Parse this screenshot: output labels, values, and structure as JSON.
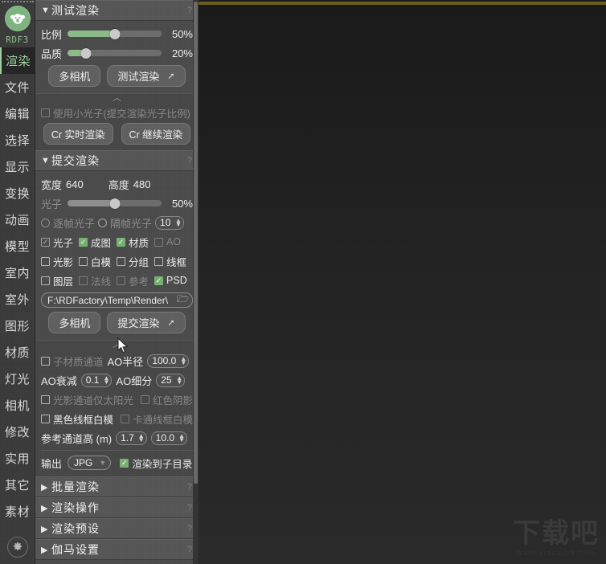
{
  "app": {
    "logo_label": "RDF3",
    "logo_icon": "koala-face-icon",
    "gear_icon": "gear-icon"
  },
  "sidebar": {
    "items": [
      {
        "label": "渲染",
        "active": true
      },
      {
        "label": "文件",
        "active": false
      },
      {
        "label": "编辑",
        "active": false
      },
      {
        "label": "选择",
        "active": false
      },
      {
        "label": "显示",
        "active": false
      },
      {
        "label": "变换",
        "active": false
      },
      {
        "label": "动画",
        "active": false
      },
      {
        "label": "模型",
        "active": false
      },
      {
        "label": "室内",
        "active": false
      },
      {
        "label": "室外",
        "active": false
      },
      {
        "label": "图形",
        "active": false
      },
      {
        "label": "材质",
        "active": false
      },
      {
        "label": "灯光",
        "active": false
      },
      {
        "label": "相机",
        "active": false
      },
      {
        "label": "修改",
        "active": false
      },
      {
        "label": "实用",
        "active": false
      },
      {
        "label": "其它",
        "active": false
      },
      {
        "label": "素材",
        "active": false
      }
    ]
  },
  "test_render": {
    "title": "测试渲染",
    "expanded_chevron": "▼",
    "help": "?",
    "scale_label": "比例",
    "scale_value": "50%",
    "scale_pct": 50,
    "quality_label": "品质",
    "quality_value": "20%",
    "quality_pct": 20,
    "multicam_button": "多相机",
    "test_render_button": "测试渲染",
    "test_render_button_icon": "up-arrow-icon"
  },
  "corona_sub": {
    "collapse_icon": "chevron-up-icon",
    "small_photon_label": "使用小光子(提交渲染光子比例)",
    "small_photon_checked": false,
    "realtime_button": "Cr 实时渲染",
    "continue_button": "Cr 继续渲染"
  },
  "submit_render": {
    "title": "提交渲染",
    "expanded_chevron": "▼",
    "help": "?",
    "width_label": "宽度",
    "width_value": "640",
    "height_label": "高度",
    "height_value": "480",
    "photon_label": "光子",
    "photon_value": "50%",
    "photon_pct": 50,
    "radio_per_frame": "逐帧光子",
    "radio_interval_frame": "隔帧光子",
    "interval_value": "10",
    "checks_row1": [
      {
        "label": "光子",
        "state": "checked-gray",
        "dim": false
      },
      {
        "label": "成图",
        "state": "checked-green",
        "dim": false
      },
      {
        "label": "材质",
        "state": "checked-green",
        "dim": false
      },
      {
        "label": "AO",
        "state": "unchecked",
        "dim": true
      }
    ],
    "checks_row2": [
      {
        "label": "光影",
        "state": "unchecked",
        "dim": false
      },
      {
        "label": "白模",
        "state": "unchecked",
        "dim": false
      },
      {
        "label": "分组",
        "state": "unchecked",
        "dim": false
      },
      {
        "label": "线框",
        "state": "unchecked",
        "dim": false
      }
    ],
    "checks_row3": [
      {
        "label": "图层",
        "state": "unchecked",
        "dim": false
      },
      {
        "label": "法线",
        "state": "unchecked",
        "dim": true
      },
      {
        "label": "参考",
        "state": "unchecked",
        "dim": true
      },
      {
        "label": "PSD",
        "state": "checked-green",
        "dim": false
      }
    ],
    "output_path": "F:\\RDFactory\\Temp\\Render\\",
    "folder_icon": "folder-icon",
    "multicam_button": "多相机",
    "submit_button": "提交渲染",
    "submit_button_icon": "up-arrow-icon"
  },
  "advanced": {
    "collapse_icon": "chevron-up-icon",
    "sub_material_channel": "子材质通道",
    "sub_material_checked": false,
    "ao_radius_label": "AO半径",
    "ao_radius_value": "100.0",
    "ao_falloff_label": "AO衰减",
    "ao_falloff_value": "0.1",
    "ao_subdiv_label": "AO细分",
    "ao_subdiv_value": "25",
    "shadow_sun_only": "光影通道仅太阳光",
    "shadow_sun_only_checked": false,
    "red_shadow": "红色阴影",
    "red_shadow_checked": false,
    "black_wire_white": "黑色线框白模",
    "black_wire_white_checked": false,
    "cartoon_wire_white": "卡通线框白模",
    "cartoon_wire_white_checked": false,
    "ref_channel_label": "参考通道高 (m)",
    "ref_height_value": "1.7",
    "ref_dist_value": "10.0",
    "output_label": "输出",
    "output_format": "JPG",
    "output_chevron": "chevron-down-icon",
    "render_subdir_label": "渲染到子目录",
    "render_subdir_checked": true
  },
  "collapsed_sections": [
    {
      "title": "批量渲染",
      "chevron": "▶",
      "help": "?"
    },
    {
      "title": "渲染操作",
      "chevron": "▶",
      "help": "?"
    },
    {
      "title": "渲染预设",
      "chevron": "▶",
      "help": "?"
    },
    {
      "title": "伽马设置",
      "chevron": "▶",
      "help": "?"
    }
  ],
  "canvas": {
    "watermark_main": "下载吧",
    "watermark_sub": "www.xiazaiba.com"
  },
  "colors": {
    "accent_green": "#7fb37f",
    "check_green": "#77b071",
    "panel_bg": "#4a4a4a",
    "rail_bg": "#3a3a3a",
    "canvas_bg": "#222222"
  }
}
